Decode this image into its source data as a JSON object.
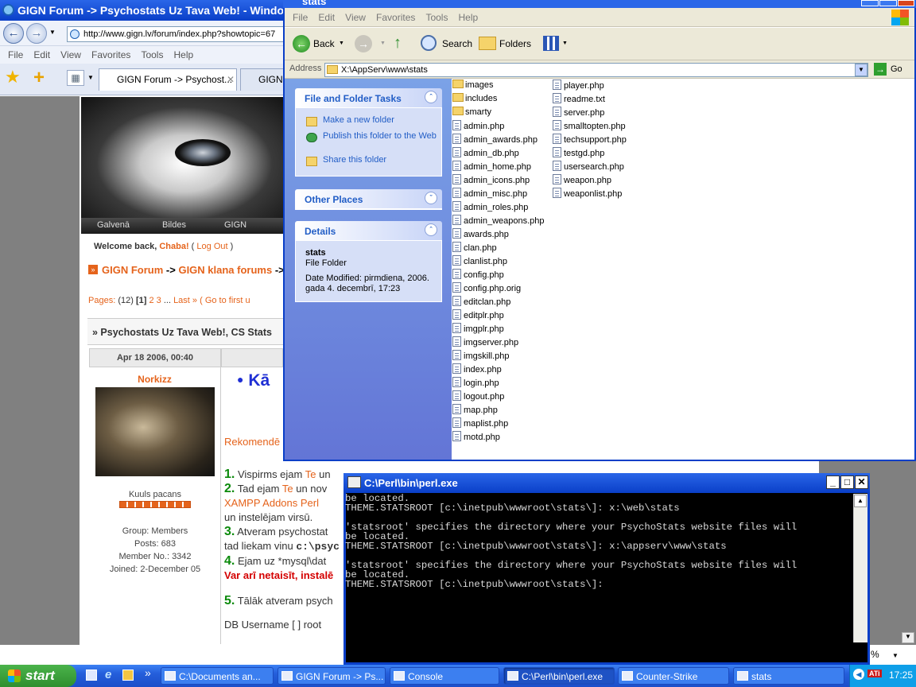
{
  "ie": {
    "title": "GIGN Forum -> Psychostats Uz Tava Web! - Windows I",
    "url": "http://www.gign.lv/forum/index.php?showtopic=67",
    "menu": [
      "File",
      "Edit",
      "View",
      "Favorites",
      "Tools",
      "Help"
    ],
    "tabs": [
      "GIGN Forum -> Psychost...",
      "GIGN F"
    ]
  },
  "forum": {
    "nav": [
      "Galvenā",
      "Bildes",
      "GIGN"
    ],
    "welcome_prefix": "Welcome back, ",
    "user": "Chaba!",
    "logout_open": " ( ",
    "logout": "Log Out",
    "logout_close": " )",
    "breadcrumb": [
      "GIGN Forum",
      "GIGN klana forums"
    ],
    "breadcrumb_sep": "->",
    "pages_label": "Pages:",
    "pages_count": "(12)",
    "page_current": "[1]",
    "page_2": "2",
    "page_3": "3",
    "page_more": "...",
    "page_last": "Last »",
    "goto_first": "( Go to first u",
    "topic_title": "» Psychostats Uz Tava Web!, CS Stats",
    "post_date": "Apr 18 2006, 00:40",
    "author": "Norkizz",
    "author_title": "Kuuls pacans",
    "group": "Group: Members",
    "posts": "Posts: 683",
    "member_no": "Member No.: 3342",
    "joined": "Joined: 2-December 05",
    "post_heading": "Kā",
    "recommend": "Rekomendē",
    "line1_num": "1.",
    "line1": "Vispirms ejam ",
    "line1b": "Te",
    "line1c": " un",
    "line2_num": "2.",
    "line2": "Tad ejam ",
    "line2b": "Te",
    "line2c": " un nov",
    "line2d": "XAMPP Addons Perl",
    "line2e": "un instelējam virsū.",
    "line3_num": "3.",
    "line3": "Atveram psychostat",
    "line3b": "tad liekam vinu ",
    "line3c": "c:\\psyc",
    "line4_num": "4.",
    "line4": "Ejam uz *mysql\\dat",
    "line4b": "Var arī netaisīt, instalē",
    "line5_num": "5.",
    "line5": "Tālāk atveram psych",
    "db_username": "DB Username [ ] root",
    "zoom": "%"
  },
  "explorer": {
    "title": "stats",
    "menu": [
      "File",
      "Edit",
      "View",
      "Favorites",
      "Tools",
      "Help"
    ],
    "back": "Back",
    "search": "Search",
    "folders": "Folders",
    "address_label": "Address",
    "address": "X:\\AppServ\\www\\stats",
    "go": "Go",
    "tasks_title": "File and Folder Tasks",
    "task_links": [
      "Make a new folder",
      "Publish this folder to the Web",
      "Share this folder"
    ],
    "other_places": "Other Places",
    "details_title": "Details",
    "details_name": "stats",
    "details_type": "File Folder",
    "details_modified": "Date Modified: pirmdiena, 2006. gada 4. decembrī, 17:23",
    "folders_list": [
      "images",
      "includes",
      "smarty"
    ],
    "files_col1": [
      "admin.php",
      "admin_awards.php",
      "admin_db.php",
      "admin_home.php",
      "admin_icons.php",
      "admin_misc.php",
      "admin_roles.php",
      "admin_weapons.php",
      "awards.php",
      "clan.php",
      "clanlist.php",
      "config.php",
      "config.php.orig",
      "editclan.php",
      "editplr.php",
      "imgplr.php",
      "imgserver.php",
      "imgskill.php",
      "index.php",
      "login.php",
      "logout.php",
      "map.php",
      "maplist.php",
      "motd.php"
    ],
    "files_col2": [
      "player.php",
      "readme.txt",
      "server.php",
      "smalltopten.php",
      "techsupport.php",
      "testgd.php",
      "usersearch.php",
      "weapon.php",
      "weaponlist.php"
    ]
  },
  "console": {
    "title": "C:\\Perl\\bin\\perl.exe",
    "lines": [
      "be located.",
      "THEME.STATSROOT [c:\\inetpub\\wwwroot\\stats\\]: x:\\web\\stats",
      "",
      "'statsroot' specifies the directory where your PsychoStats website files will",
      "be located.",
      "THEME.STATSROOT [c:\\inetpub\\wwwroot\\stats\\]: x:\\appserv\\www\\stats",
      "",
      "'statsroot' specifies the directory where your PsychoStats website files will",
      "be located.",
      "THEME.STATSROOT [c:\\inetpub\\wwwroot\\stats\\]:"
    ]
  },
  "taskbar": {
    "start": "start",
    "items": [
      "C:\\Documents an...",
      "GIGN Forum -> Ps...",
      "Console",
      "C:\\Perl\\bin\\perl.exe",
      "Counter-Strike",
      "stats"
    ],
    "clock": "17:25",
    "tray_label": "ATi"
  }
}
